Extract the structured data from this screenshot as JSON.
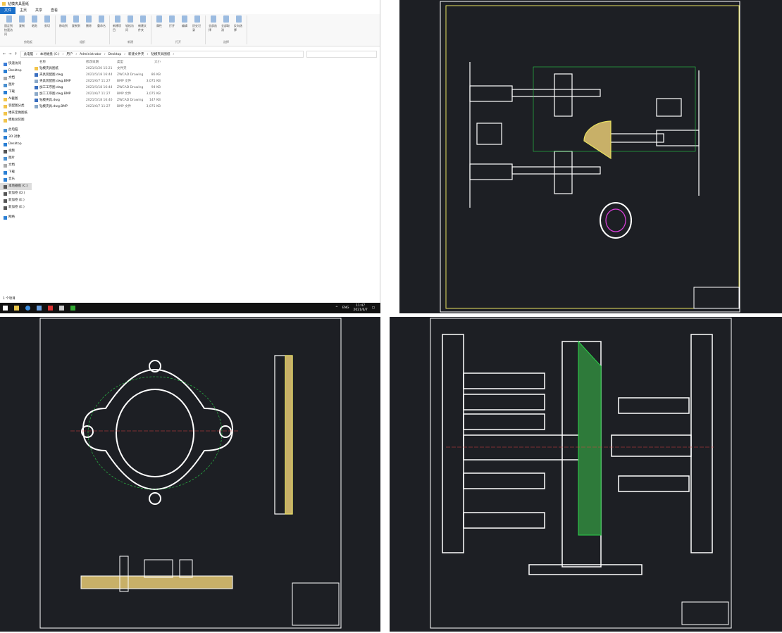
{
  "explorer": {
    "title": "钻模夹具图纸",
    "menu": [
      "文件",
      "主页",
      "共享",
      "查看"
    ],
    "ribbon_groups": [
      {
        "label": "剪贴板",
        "buttons": [
          "固定到快速访问",
          "复制",
          "粘贴",
          "剪切"
        ]
      },
      {
        "label": "组织",
        "buttons": [
          "移动到",
          "复制到",
          "删除",
          "重命名"
        ]
      },
      {
        "label": "新建",
        "buttons": [
          "新建项目",
          "轻松访问",
          "新建文件夹"
        ]
      },
      {
        "label": "打开",
        "buttons": [
          "属性",
          "打开",
          "编辑",
          "历史记录"
        ]
      },
      {
        "label": "选择",
        "buttons": [
          "全部选择",
          "全部取消",
          "反向选择"
        ]
      }
    ],
    "breadcrumb": [
      "此电脑",
      "本地磁盘 (C:)",
      "用户",
      "Administrator",
      "Desktop",
      "新建文件夹",
      "钻模夹具图纸"
    ],
    "sidebar": [
      {
        "label": "快速访问",
        "icon": "star-icon",
        "color": "#3b7dd8"
      },
      {
        "label": "Desktop",
        "icon": "desktop-icon",
        "color": "#2a7fd4"
      },
      {
        "label": "文档",
        "icon": "document-icon",
        "color": "#aaa"
      },
      {
        "label": "图片",
        "icon": "picture-icon",
        "color": "#4a90d0"
      },
      {
        "label": "下载",
        "icon": "download-icon",
        "color": "#2a7fd4"
      },
      {
        "label": "AI截图",
        "icon": "folder-icon",
        "color": "#f2c44b"
      },
      {
        "label": "装配图分类",
        "icon": "folder-icon",
        "color": "#f2c44b"
      },
      {
        "label": "楼夹定做图纸",
        "icon": "folder-icon",
        "color": "#f2c44b"
      },
      {
        "label": "模板总装图",
        "icon": "folder-icon",
        "color": "#f2c44b"
      },
      {
        "label": "此电脑",
        "icon": "computer-icon",
        "color": "#4a90d0"
      },
      {
        "label": "3D 对象",
        "icon": "cube-icon",
        "color": "#2a7fd4"
      },
      {
        "label": "Desktop",
        "icon": "desktop-icon",
        "color": "#2a7fd4"
      },
      {
        "label": "视频",
        "icon": "video-icon",
        "color": "#555"
      },
      {
        "label": "图片",
        "icon": "picture-icon",
        "color": "#4a90d0"
      },
      {
        "label": "文档",
        "icon": "document-icon",
        "color": "#aaa"
      },
      {
        "label": "下载",
        "icon": "download-icon",
        "color": "#2a7fd4"
      },
      {
        "label": "音乐",
        "icon": "music-icon",
        "color": "#2a7fd4"
      },
      {
        "label": "本地磁盘 (C:)",
        "icon": "drive-icon",
        "color": "#555",
        "selected": true
      },
      {
        "label": "新加卷 (D:)",
        "icon": "drive-icon",
        "color": "#555"
      },
      {
        "label": "新加卷 (E:)",
        "icon": "drive-icon",
        "color": "#555"
      },
      {
        "label": "新加卷 (E:)",
        "icon": "drive-icon",
        "color": "#555"
      },
      {
        "label": "网络",
        "icon": "network-icon",
        "color": "#2a7fd4"
      }
    ],
    "columns": [
      "名称",
      "修改日期",
      "类型",
      "大小"
    ],
    "files": [
      {
        "name": "钻模夹具图纸",
        "date": "2021/5/20 15:21",
        "type": "文件夹",
        "size": "",
        "icon": "folder-icon"
      },
      {
        "name": "夹具装配图.dwg",
        "date": "2021/5/18 16:44",
        "type": "ZWCAD Drawing",
        "size": "86 KB",
        "icon": "dwg-file-icon"
      },
      {
        "name": "夹具装配图.dwg.BMP",
        "date": "2021/6/7 11:27",
        "type": "BMP 文件",
        "size": "3,075 KB",
        "icon": "bmp-file-icon"
      },
      {
        "name": "加工工序图.dwg",
        "date": "2021/5/18 16:44",
        "type": "ZWCAD Drawing",
        "size": "94 KB",
        "icon": "dwg-file-icon"
      },
      {
        "name": "加工工序图.dwg.BMP",
        "date": "2021/6/7 11:27",
        "type": "BMP 文件",
        "size": "3,075 KB",
        "icon": "bmp-file-icon"
      },
      {
        "name": "钻模夹具.dwg",
        "date": "2021/5/18 16:40",
        "type": "ZWCAD Drawing",
        "size": "147 KB",
        "icon": "dwg-file-icon"
      },
      {
        "name": "钻模夹具.dwg.BMP",
        "date": "2021/6/7 11:27",
        "type": "BMP 文件",
        "size": "3,075 KB",
        "icon": "bmp-file-icon"
      }
    ],
    "status": "1 个项目"
  },
  "taskbar": {
    "lang": "ENG",
    "time": "11:47",
    "date": "2021/6/7"
  },
  "colors": {
    "cad_bg": "#1d1f24",
    "accent": "#1a6fc9",
    "cad_green": "#2bd14a",
    "cad_yellow": "#e8e060",
    "cad_magenta": "#e040e0"
  }
}
